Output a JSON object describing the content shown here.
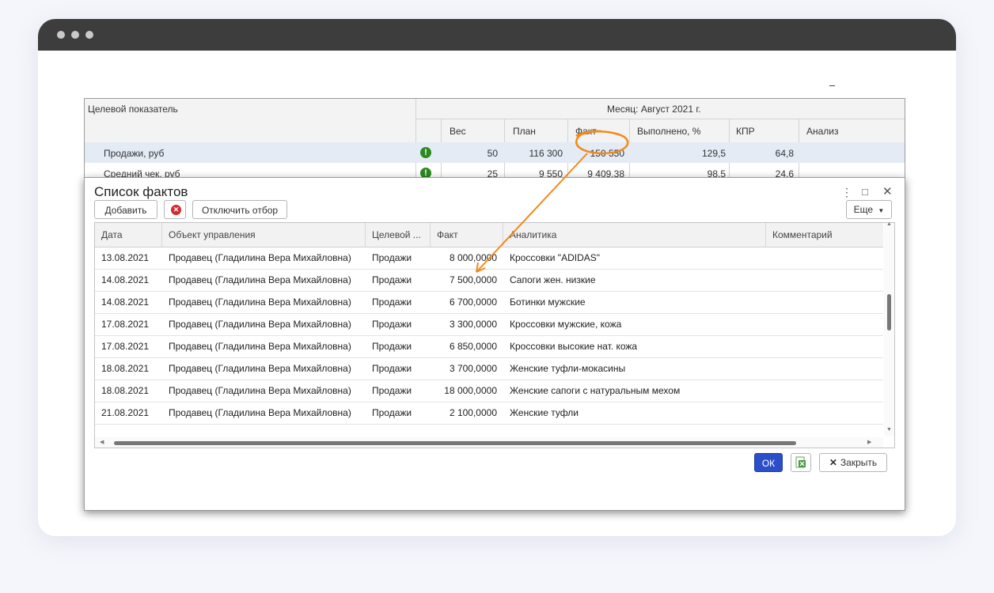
{
  "report": {
    "col_target": "Целевой показатель",
    "month_header": "Месяц: Август 2021 г.",
    "cols": [
      "Вес",
      "План",
      "Факт",
      "Выполнено, %",
      "КПР",
      "Анализ"
    ],
    "rows": [
      {
        "name": "Продажи, руб",
        "weight": "50",
        "plan": "116 300",
        "fact": "150 550",
        "done": "129,5",
        "kpr": "64,8"
      },
      {
        "name": "Средний чек, руб",
        "weight": "25",
        "plan": "9 550",
        "fact": "9 409,38",
        "done": "98,5",
        "kpr": "24,6"
      }
    ]
  },
  "dialog": {
    "title": "Список фактов",
    "add_label": "Добавить",
    "filter_off_label": "Отключить отбор",
    "more_label": "Еще",
    "ok_label": "ОК",
    "close_label": "Закрыть",
    "columns": [
      "Дата",
      "Объект управления",
      "Целевой ...",
      "Факт",
      "Аналитика",
      "Комментарий"
    ],
    "rows": [
      {
        "date": "13.08.2021",
        "obj": "Продавец (Гладилина Вера Михайловна)",
        "target": "Продажи",
        "fact": "8 000,0000",
        "analytics": "Кроссовки \"ADIDAS\"",
        "comment": ""
      },
      {
        "date": "14.08.2021",
        "obj": "Продавец (Гладилина Вера Михайловна)",
        "target": "Продажи",
        "fact": "7 500,0000",
        "analytics": "Сапоги жен. низкие",
        "comment": ""
      },
      {
        "date": "14.08.2021",
        "obj": "Продавец (Гладилина Вера Михайловна)",
        "target": "Продажи",
        "fact": "6 700,0000",
        "analytics": "Ботинки мужские",
        "comment": ""
      },
      {
        "date": "17.08.2021",
        "obj": "Продавец (Гладилина Вера Михайловна)",
        "target": "Продажи",
        "fact": "3 300,0000",
        "analytics": "Кроссовки мужские, кожа",
        "comment": ""
      },
      {
        "date": "17.08.2021",
        "obj": "Продавец (Гладилина Вера Михайловна)",
        "target": "Продажи",
        "fact": "6 850,0000",
        "analytics": "Кроссовки высокие нат. кожа",
        "comment": ""
      },
      {
        "date": "18.08.2021",
        "obj": "Продавец (Гладилина Вера Михайловна)",
        "target": "Продажи",
        "fact": "3 700,0000",
        "analytics": "Женские туфли-мокасины",
        "comment": ""
      },
      {
        "date": "18.08.2021",
        "obj": "Продавец (Гладилина Вера Михайловна)",
        "target": "Продажи",
        "fact": "18 000,0000",
        "analytics": "Женские сапоги с натуральным мехом",
        "comment": ""
      },
      {
        "date": "21.08.2021",
        "obj": "Продавец (Гладилина Вера Михайловна)",
        "target": "Продажи",
        "fact": "2 100,0000",
        "analytics": "Женские туфли",
        "comment": ""
      }
    ]
  },
  "colors": {
    "annotation": "#f28a1a",
    "ok_button": "#2a4fc9",
    "status_ok": "#2c8a1f"
  }
}
